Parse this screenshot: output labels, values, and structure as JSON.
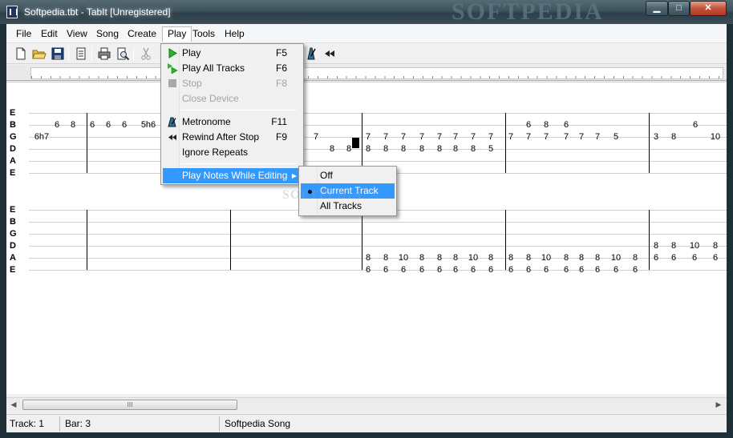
{
  "window": {
    "title": "Softpedia.tbt - TabIt  [Unregistered]",
    "watermark": "SOFTPEDIA"
  },
  "menubar": {
    "items": [
      "File",
      "Edit",
      "View",
      "Song",
      "Create",
      "Play",
      "Tools",
      "Help"
    ],
    "active": "Play"
  },
  "toolbar": {
    "buttons": [
      "new-file-icon",
      "open-folder-icon",
      "save-icon",
      "song-properties-icon",
      "print-icon",
      "print-preview-icon",
      "cut-icon",
      "metronome-icon",
      "rewind-icon"
    ]
  },
  "tablature": {
    "string_names": [
      "E",
      "B",
      "G",
      "D",
      "A",
      "E"
    ],
    "staff1_visible_notes": {
      "E": [],
      "B": [
        "6",
        "8",
        "6",
        "6",
        "6",
        "5h6",
        "6",
        "8",
        "6",
        "6"
      ],
      "G": [
        "6h7",
        "7",
        "7",
        "7",
        "7",
        "7",
        "7",
        "7",
        "7",
        "7",
        "7",
        "7",
        "7",
        "7",
        "7",
        "7",
        "5",
        "3",
        "8",
        "10",
        "8"
      ],
      "D": [
        "8",
        "8",
        "8",
        "8",
        "8",
        "8",
        "8",
        "8",
        "8",
        "5"
      ],
      "A": []
    },
    "staff2_visible_notes": {
      "D": [
        "8",
        "8",
        "10",
        "8"
      ],
      "A": [
        "8",
        "8",
        "10",
        "8",
        "8",
        "8",
        "10",
        "8",
        "8",
        "8",
        "10",
        "8",
        "8",
        "8",
        "10",
        "8",
        "6",
        "6",
        "6",
        "6"
      ],
      "E": [
        "6",
        "6",
        "6",
        "6",
        "6",
        "6",
        "6",
        "6",
        "6",
        "6",
        "6",
        "6",
        "6",
        "6",
        "6",
        "6"
      ]
    }
  },
  "play_menu": {
    "items": [
      {
        "label": "Play",
        "shortcut": "F5",
        "enabled": true,
        "icon": "play-icon"
      },
      {
        "label": "Play All Tracks",
        "shortcut": "F6",
        "enabled": true,
        "icon": "play-all-icon"
      },
      {
        "label": "Stop",
        "shortcut": "F8",
        "enabled": false,
        "icon": "stop-icon"
      },
      {
        "label": "Close Device",
        "shortcut": "",
        "enabled": false,
        "icon": ""
      },
      {
        "label": "Metronome",
        "shortcut": "F11",
        "enabled": true,
        "icon": "metronome-icon"
      },
      {
        "label": "Rewind After Stop",
        "shortcut": "F9",
        "enabled": true,
        "icon": "rewind-icon"
      },
      {
        "label": "Ignore Repeats",
        "shortcut": "",
        "enabled": true,
        "icon": ""
      },
      {
        "label": "Play Notes While Editing",
        "shortcut": "",
        "enabled": true,
        "icon": "",
        "highlighted": true,
        "submenu": true
      }
    ]
  },
  "submenu": {
    "items": [
      {
        "label": "Off"
      },
      {
        "label": "Current Track",
        "selected": true,
        "highlighted": true
      },
      {
        "label": "All Tracks"
      }
    ]
  },
  "statusbar": {
    "track": "Track: 1",
    "bar": "Bar: 3",
    "song": "Softpedia Song"
  },
  "scrollbar": {
    "thumb_grip": "III"
  }
}
